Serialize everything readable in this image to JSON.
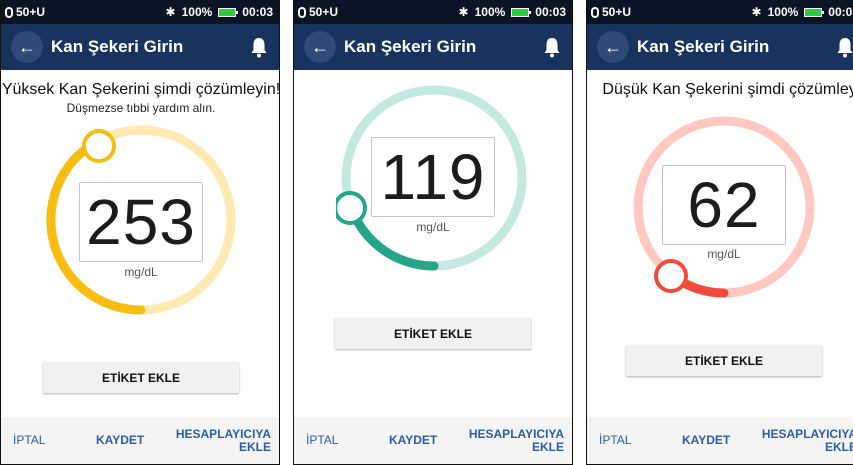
{
  "status_bar": {
    "pod_label": "50+U",
    "battery": "100%",
    "time": "00:03",
    "icons": [
      "pod-icon",
      "bluetooth-icon",
      "battery-icon"
    ]
  },
  "app_bar": {
    "title": "Kan Şekeri Girin",
    "back_icon": "back-arrow-icon",
    "bell_icon": "bell-icon"
  },
  "colors": {
    "app_bar": "#17335e",
    "status_bar": "#0b1424",
    "high_track": "#ffeab4",
    "high_arc": "#f7bd10",
    "normal_track": "#c3e9e0",
    "normal_arc": "#25a68a",
    "low_track": "#ffc9c1",
    "low_arc": "#f24a3a",
    "footer_link": "#2a5fa8"
  },
  "screens": [
    {
      "headline": "Yüksek Kan Şekerini şimdi çözümleyin!",
      "subline": "Düşmezse tıbbi yardım alın.",
      "reading": "253",
      "unit": "mg/dL",
      "tag_button": "ETİKET EKLE",
      "range": "high"
    },
    {
      "headline": "",
      "subline": "",
      "reading": "119",
      "unit": "mg/dL",
      "tag_button": "ETİKET EKLE",
      "range": "normal"
    },
    {
      "headline": "Düşük Kan Şekerini şimdi çözümleyin!",
      "subline": "",
      "reading": "62",
      "unit": "mg/dL",
      "tag_button": "ETİKET EKLE",
      "range": "low"
    }
  ],
  "footer": {
    "cancel": "İPTAL",
    "save": "KAYDET",
    "add_to_calculator": "HESAPLAYICIYA EKLE"
  }
}
